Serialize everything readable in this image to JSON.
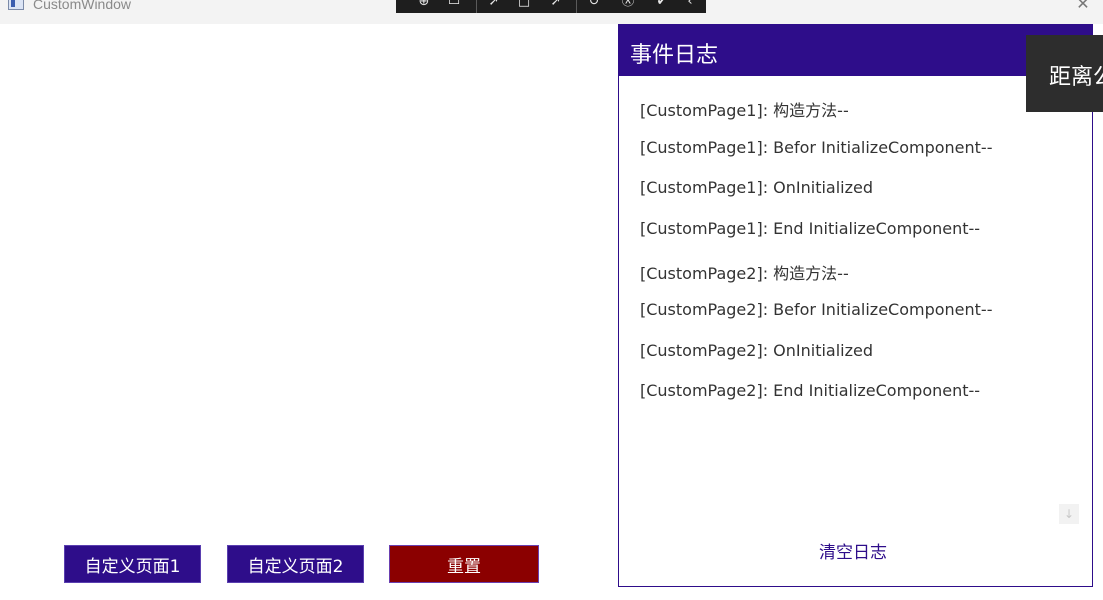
{
  "window": {
    "title": "CustomWindow",
    "close_glyph": "✕"
  },
  "debug_toolbar": {
    "icons": [
      "select-element-icon",
      "record-icon",
      "pointer-icon",
      "layout-icon",
      "pointer-select-icon",
      "hot-reload-icon",
      "accessibility-icon",
      "check-icon",
      "collapse-icon"
    ]
  },
  "nav": {
    "page1_label": "自定义页面1",
    "page2_label": "自定义页面2",
    "reset_label": "重置"
  },
  "log": {
    "title": "事件日志",
    "entries": [
      "[CustomPage1]: 构造方法--",
      "[CustomPage1]: Befor InitializeComponent--",
      "[CustomPage1]: OnInitialized",
      "[CustomPage1]: End InitializeComponent--",
      "[CustomPage2]: 构造方法--",
      "[CustomPage2]: Befor InitializeComponent--",
      "[CustomPage2]: OnInitialized",
      "[CustomPage2]: End InitializeComponent--"
    ],
    "clear_label": "清空日志",
    "scroll_glyph": "↓"
  },
  "overlay": {
    "text": "距离公"
  },
  "colors": {
    "accent": "#2e0d8a",
    "danger": "#8b0000",
    "text": "#333333"
  }
}
